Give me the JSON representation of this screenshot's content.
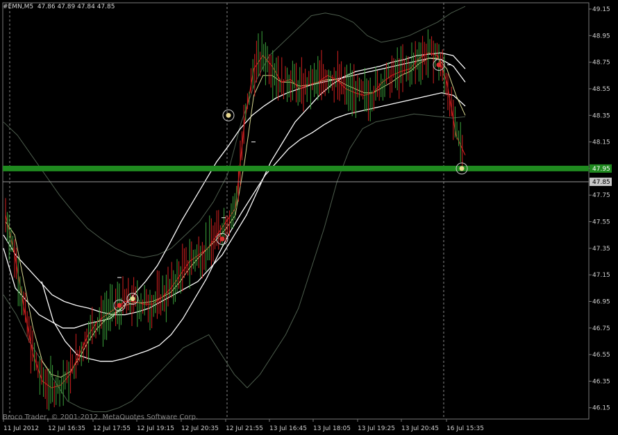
{
  "header": {
    "symbol": "#EMN,M5",
    "ohlc": "47.86 47.89 47.84 47.85"
  },
  "footer": {
    "copyright": "Broco Trader, © 2001-2012, MetaQuotes Software Corp."
  },
  "chart_data": {
    "type": "line",
    "title": "",
    "grid": false,
    "ylim": [
      46.1,
      49.2
    ],
    "y_ticks": [
      "49.15",
      "48.95",
      "48.75",
      "48.55",
      "48.35",
      "48.15",
      "47.95",
      "47.75",
      "47.55",
      "47.35",
      "47.15",
      "46.95",
      "46.75",
      "46.55",
      "46.35",
      "46.15"
    ],
    "x_ticks": [
      "11 Jul 2012",
      "12 Jul 16:35",
      "12 Jul 17:55",
      "12 Jul 19:15",
      "12 Jul 20:35",
      "12 Jul 21:55",
      "13 Jul 16:45",
      "13 Jul 18:05",
      "13 Jul 19:25",
      "13 Jul 20:45",
      "16 Jul 15:35"
    ],
    "current_price": "47.85",
    "level_line": "47.95",
    "colors": {
      "level": "#1f8a1f",
      "fast_ma": "#d42020",
      "slow_ma": "#d8d890",
      "envelope": "#ffffff",
      "bollinger": "#4d5d4d",
      "up_bar": "#3ca53c",
      "down_bar": "#d42020"
    },
    "series": [
      {
        "values": [
          47.6,
          47.3,
          46.9,
          46.55,
          46.35,
          46.3,
          46.32,
          46.4,
          46.55,
          46.7,
          46.8,
          46.85,
          46.9,
          46.95,
          46.95,
          46.93,
          46.93,
          46.98,
          47.05,
          47.15,
          47.25,
          47.3,
          47.35,
          47.45,
          47.55,
          47.65,
          48.3,
          48.7,
          48.8,
          48.72,
          48.6,
          48.62,
          48.55,
          48.58,
          48.6,
          48.65,
          48.62,
          48.55,
          48.52,
          48.5,
          48.52,
          48.6,
          48.65,
          48.68,
          48.7,
          48.78,
          48.82,
          48.8,
          48.6,
          48.2,
          48.05
        ]
      },
      {
        "values": [
          47.55,
          47.45,
          47.1,
          46.75,
          46.5,
          46.4,
          46.38,
          46.42,
          46.52,
          46.65,
          46.75,
          46.82,
          46.87,
          46.92,
          46.94,
          46.94,
          46.95,
          46.98,
          47.02,
          47.1,
          47.2,
          47.28,
          47.35,
          47.42,
          47.5,
          47.6,
          48.0,
          48.5,
          48.65,
          48.65,
          48.6,
          48.6,
          48.57,
          48.58,
          48.6,
          48.62,
          48.62,
          48.58,
          48.55,
          48.52,
          48.52,
          48.56,
          48.6,
          48.65,
          48.68,
          48.74,
          48.78,
          48.78,
          48.7,
          48.5,
          48.35
        ]
      },
      {
        "values": [
          47.45,
          47.3,
          47.2,
          47.1,
          47.0,
          46.95,
          46.92,
          46.9,
          46.87,
          46.85,
          46.85,
          46.87,
          46.9,
          46.95,
          47.0,
          47.05,
          47.1,
          47.2,
          47.3,
          47.45,
          47.6,
          47.8,
          48.0,
          48.15,
          48.3,
          48.4,
          48.5,
          48.58,
          48.64,
          48.68,
          48.7,
          48.72,
          48.75,
          48.77,
          48.8,
          48.81,
          48.82,
          48.8,
          48.7
        ]
      },
      {
        "values": [
          47.35,
          47.05,
          46.95,
          46.85,
          46.8,
          46.75,
          46.75,
          46.78,
          46.8,
          46.82,
          46.9,
          47.0,
          47.1,
          47.22,
          47.38,
          47.55,
          47.7,
          47.85,
          48.0,
          48.12,
          48.25,
          48.35,
          48.42,
          48.48,
          48.52,
          48.55,
          48.58,
          48.6,
          48.62,
          48.64,
          48.66,
          48.68,
          48.7,
          48.72,
          48.74,
          48.76,
          48.78,
          48.77,
          48.72,
          48.6
        ]
      },
      {
        "values": [
          47.1,
          46.8,
          46.65,
          46.55,
          46.52,
          46.5,
          46.5,
          46.52,
          46.55,
          46.58,
          46.62,
          46.7,
          46.82,
          46.97,
          47.12,
          47.3,
          47.47,
          47.62,
          47.76,
          47.9,
          48.0,
          48.1,
          48.17,
          48.22,
          48.28,
          48.33,
          48.36,
          48.38,
          48.4,
          48.42,
          48.44,
          48.46,
          48.48,
          48.5,
          48.52,
          48.5,
          48.42
        ]
      },
      {
        "values": [
          48.3,
          48.2,
          48.05,
          47.9,
          47.75,
          47.62,
          47.5,
          47.42,
          47.35,
          47.3,
          47.28,
          47.3,
          47.35,
          47.45,
          47.55,
          47.7,
          47.9,
          48.3,
          48.6,
          48.8,
          48.9,
          49.0,
          49.1,
          49.12,
          49.1,
          49.05,
          48.95,
          48.9,
          48.92,
          48.95,
          49.0,
          49.05,
          49.12,
          49.17
        ]
      },
      {
        "values": [
          47.0,
          46.85,
          46.65,
          46.5,
          46.35,
          46.2,
          46.15,
          46.12,
          46.12,
          46.15,
          46.2,
          46.3,
          46.4,
          46.5,
          46.6,
          46.65,
          46.7,
          46.55,
          46.4,
          46.3,
          46.4,
          46.55,
          46.7,
          46.9,
          47.2,
          47.5,
          47.85,
          48.1,
          48.25,
          48.3,
          48.32,
          48.34,
          48.36,
          48.35,
          48.34,
          48.33,
          48.34
        ]
      }
    ]
  }
}
